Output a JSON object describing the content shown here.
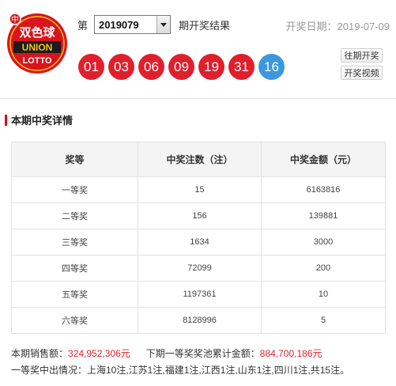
{
  "logo": {
    "text_cn": "双色球",
    "text_en_1": "UNION",
    "text_en_2": "LOTTO"
  },
  "period": {
    "prefix": "第",
    "selected": "2019079",
    "suffix": "期开奖结果"
  },
  "draw_date": "开奖日期：2019-07-09",
  "balls": {
    "red": [
      "01",
      "03",
      "06",
      "09",
      "19",
      "31"
    ],
    "blue": "16",
    "colors": {
      "red": "#e01f2d",
      "blue": "#3a98e0"
    }
  },
  "buttons": {
    "history": "往期开奖",
    "video": "开奖视频"
  },
  "section": {
    "title": "本期中奖详情"
  },
  "table": {
    "headers": [
      "奖等",
      "中奖注数（注）",
      "中奖金额（元）"
    ],
    "rows": [
      [
        "一等奖",
        "15",
        "6163816"
      ],
      [
        "二等奖",
        "156",
        "139881"
      ],
      [
        "三等奖",
        "1634",
        "3000"
      ],
      [
        "四等奖",
        "72099",
        "200"
      ],
      [
        "五等奖",
        "1197361",
        "10"
      ],
      [
        "六等奖",
        "8128996",
        "5"
      ]
    ]
  },
  "summary": {
    "sales_label": "本期销售额：",
    "sales_value": "324,952,306元",
    "pool_label": "下期一等奖奖池累计金额：",
    "pool_value": "884,700,186元",
    "winners_text": "一等奖中出情况：上海10注,江苏1注,福建1注,江西1注,山东1注,四川1注,共15注。"
  }
}
